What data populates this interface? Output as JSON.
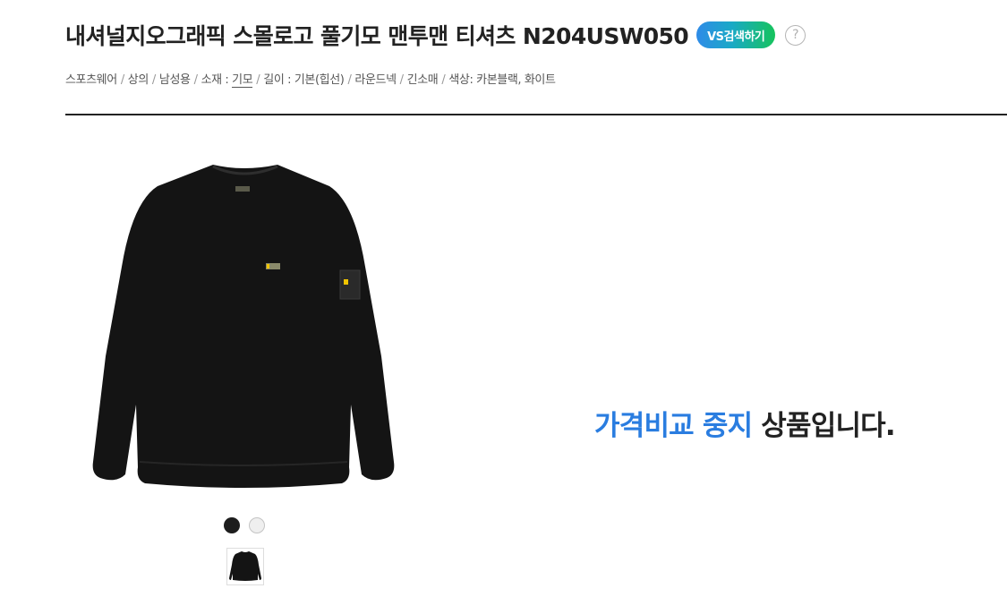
{
  "product": {
    "title": "내셔널지오그래픽 스몰로고 풀기모 맨투맨 티셔츠 N204USW050",
    "vs_button_label": "VS검색하기",
    "help_label": "?"
  },
  "specs": {
    "category1": "스포츠웨어",
    "category2": "상의",
    "gender": "남성용",
    "material_key": "소재 :",
    "material_value": "기모",
    "length_key": "길이 :",
    "length_value": "기본(힙선)",
    "neck": "라운드넥",
    "sleeve": "긴소매",
    "color_key": "색상:",
    "color_value": "카본블랙, 화이트",
    "separator": "/"
  },
  "colors": {
    "accent_blue": "#2a7de0",
    "vs_gradient_start": "#2f8be8",
    "vs_gradient_end": "#16c35c",
    "garment": "#141414"
  },
  "swatches": [
    {
      "name": "카본블랙",
      "hex": "#1d1d1d"
    },
    {
      "name": "화이트",
      "hex": "#efefef"
    }
  ],
  "notice": {
    "highlight": "가격비교 중지",
    "rest": " 상품입니다."
  }
}
